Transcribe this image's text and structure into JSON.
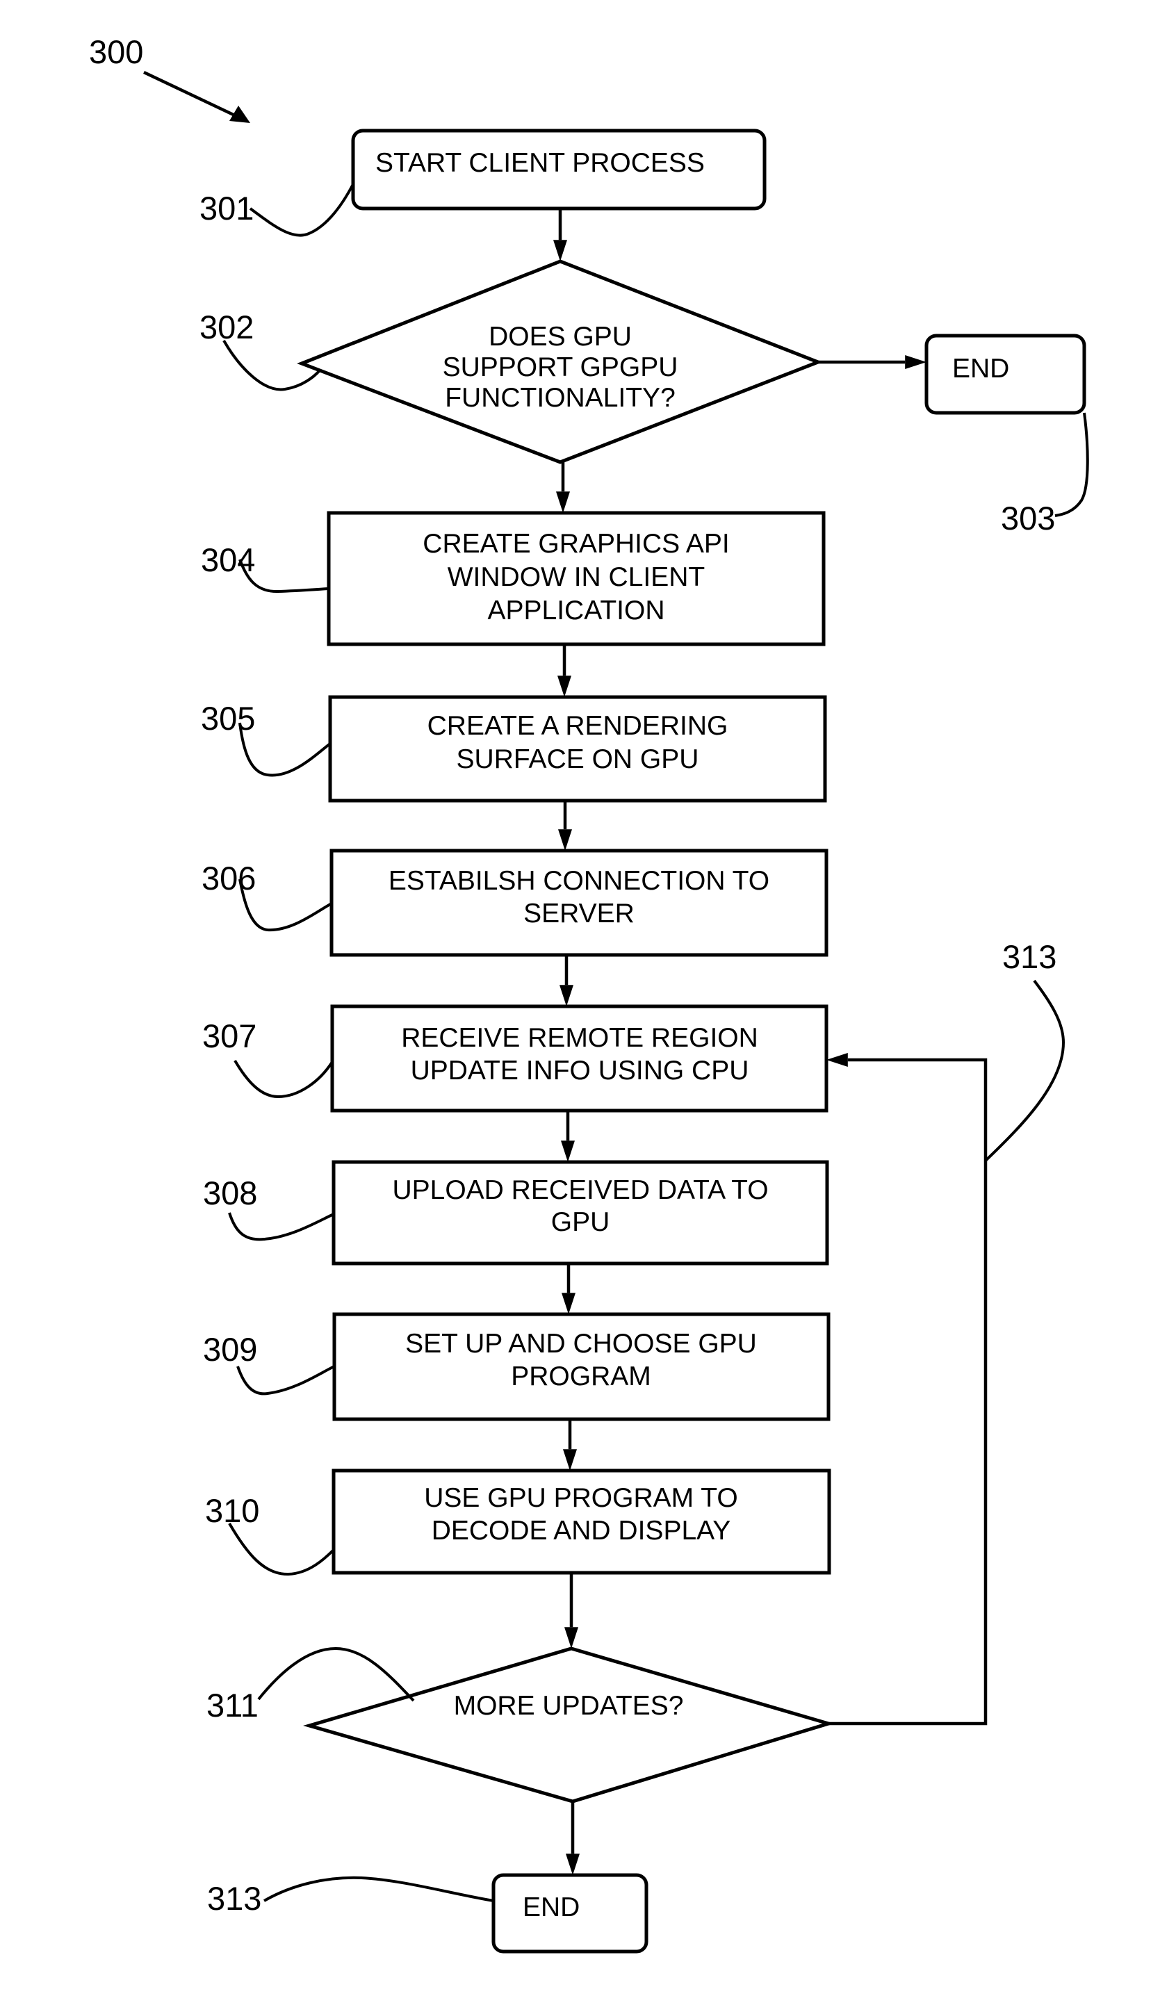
{
  "figure": {
    "reference": "300",
    "background": "#ffffff",
    "ink": "#000000"
  },
  "steps": {
    "start": {
      "ref": "301",
      "lines": [
        "START CLIENT PROCESS"
      ]
    },
    "gpgpu_check": {
      "ref": "302",
      "lines": [
        "DOES GPU",
        "SUPPORT GPGPU",
        "FUNCTIONALITY?"
      ]
    },
    "end_unsupported": {
      "ref": "303",
      "lines": [
        "END"
      ]
    },
    "create_window": {
      "ref": "304",
      "lines": [
        "CREATE GRAPHICS API",
        "WINDOW IN CLIENT",
        "APPLICATION"
      ]
    },
    "create_surface": {
      "ref": "305",
      "lines": [
        "CREATE A RENDERING",
        "SURFACE ON GPU"
      ]
    },
    "connect_server": {
      "ref": "306",
      "lines": [
        "ESTABILSH CONNECTION TO",
        "SERVER"
      ]
    },
    "receive_update": {
      "ref": "307",
      "lines": [
        "RECEIVE REMOTE REGION",
        "UPDATE INFO USING CPU"
      ]
    },
    "upload_data": {
      "ref": "308",
      "lines": [
        "UPLOAD RECEIVED DATA TO",
        "GPU"
      ]
    },
    "choose_program": {
      "ref": "309",
      "lines": [
        "SET UP AND CHOOSE GPU",
        "PROGRAM"
      ]
    },
    "decode_display": {
      "ref": "310",
      "lines": [
        "USE GPU PROGRAM TO",
        "DECODE AND DISPLAY"
      ]
    },
    "more_updates": {
      "ref": "311",
      "lines": [
        "MORE UPDATES?"
      ]
    },
    "end_final": {
      "ref": "313",
      "lines": [
        "END"
      ]
    }
  },
  "loop": {
    "ref": "313"
  }
}
